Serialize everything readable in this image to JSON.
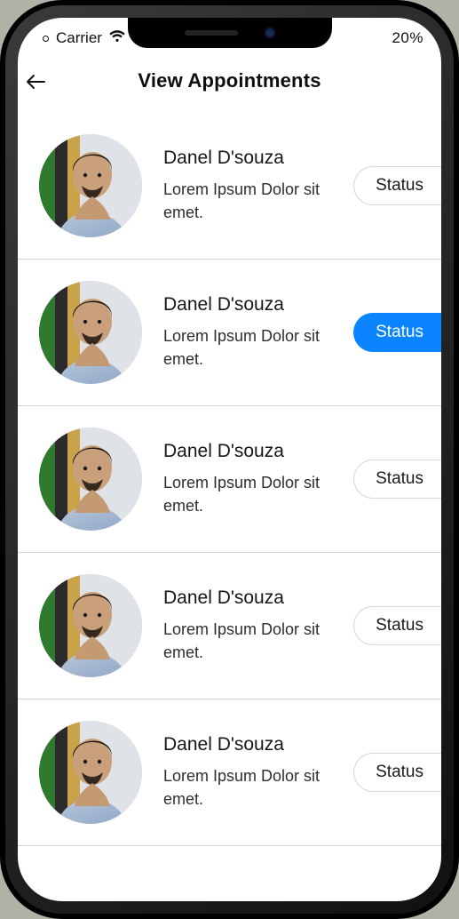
{
  "statusbar": {
    "carrier": "Carrier",
    "battery": "20%"
  },
  "header": {
    "title": "View Appointments"
  },
  "appointments": [
    {
      "name": "Danel D'souza",
      "desc": "Lorem Ipsum Dolor sit emet.",
      "status_label": "Status",
      "active": false
    },
    {
      "name": "Danel D'souza",
      "desc": "Lorem Ipsum Dolor sit emet.",
      "status_label": "Status",
      "active": true
    },
    {
      "name": "Danel D'souza",
      "desc": "Lorem Ipsum Dolor sit emet.",
      "status_label": "Status",
      "active": false
    },
    {
      "name": "Danel D'souza",
      "desc": "Lorem Ipsum Dolor sit emet.",
      "status_label": "Status",
      "active": false
    },
    {
      "name": "Danel D'souza",
      "desc": "Lorem Ipsum Dolor sit emet.",
      "status_label": "Status",
      "active": false
    }
  ]
}
